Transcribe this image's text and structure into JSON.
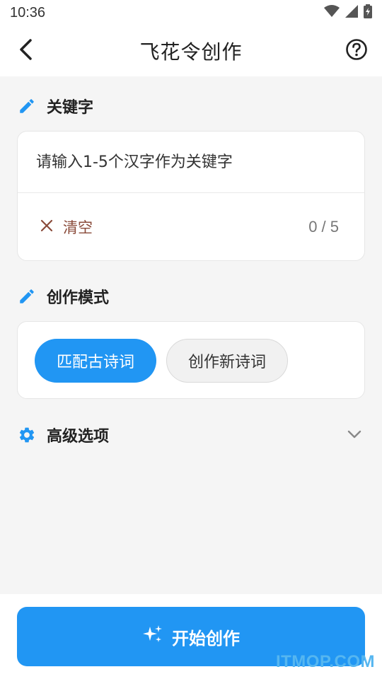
{
  "status_bar": {
    "time": "10:36",
    "icons": [
      "wifi-icon",
      "signal-icon",
      "battery-icon"
    ]
  },
  "app_bar": {
    "title": "飞花令创作",
    "back_icon": "back-arrow-icon",
    "help_icon": "help-circle-icon"
  },
  "keyword_section": {
    "title": "关键字",
    "icon": "pencil-icon",
    "input_value": "",
    "input_placeholder": "请输入1-5个汉字作为关键字",
    "clear_label": "清空",
    "counter": "0 / 5"
  },
  "mode_section": {
    "title": "创作模式",
    "icon": "pencil-icon",
    "options": [
      {
        "label": "匹配古诗词",
        "selected": true
      },
      {
        "label": "创作新诗词",
        "selected": false
      }
    ]
  },
  "advanced_section": {
    "title": "高级选项",
    "icon": "gear-icon",
    "expanded": false
  },
  "start_button": {
    "label": "开始创作",
    "icon": "sparkle-icon"
  },
  "watermark": "ITMOP.COM",
  "colors": {
    "accent": "#2196f3",
    "clear": "#8a4b3a",
    "background": "#f5f5f5"
  }
}
